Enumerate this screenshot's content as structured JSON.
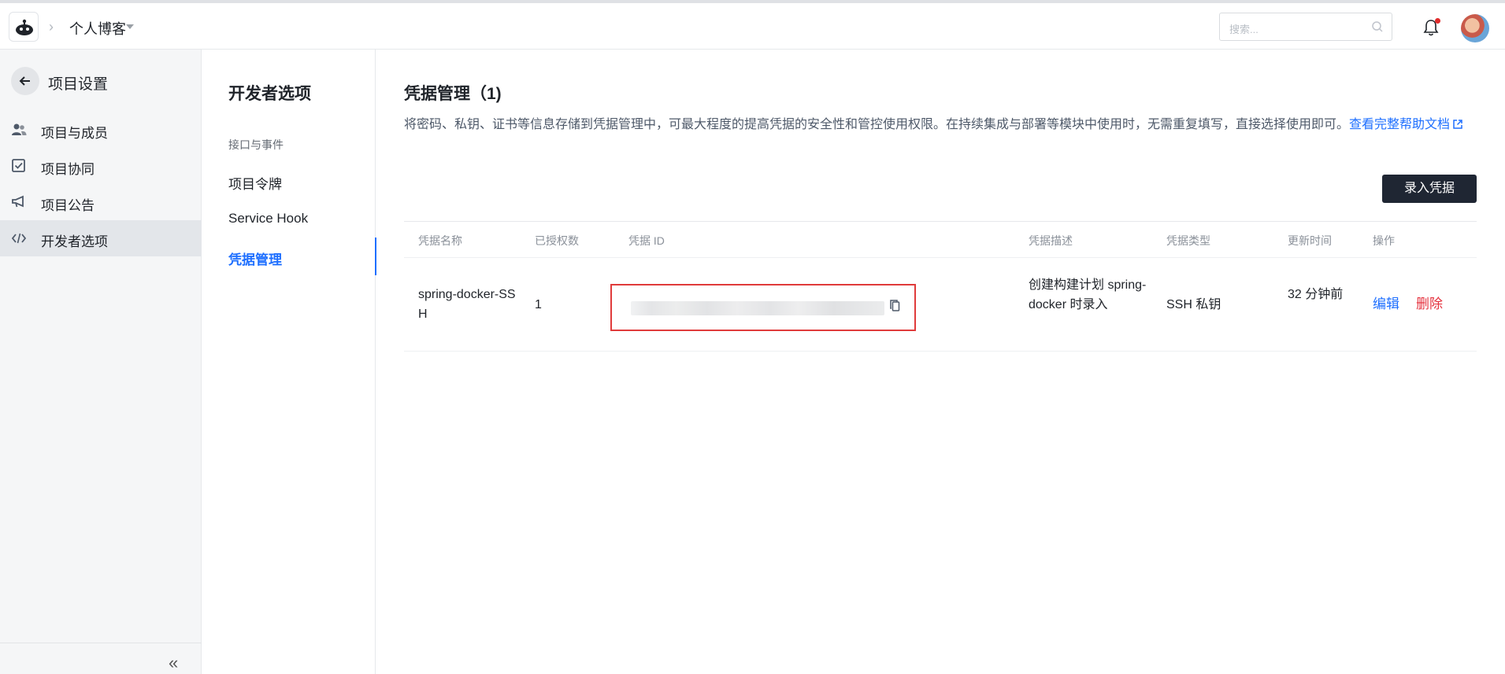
{
  "topbar": {
    "project_name": "个人博客",
    "search_placeholder": "搜索...",
    "icons": [
      "logo-icon",
      "chevron-right-icon",
      "caret-down-icon",
      "search-icon",
      "bell-icon",
      "avatar"
    ]
  },
  "sidebar": {
    "title": "项目设置",
    "items": [
      {
        "label": "项目与成员",
        "icon": "members-icon"
      },
      {
        "label": "项目协同",
        "icon": "collab-icon"
      },
      {
        "label": "项目公告",
        "icon": "megaphone-icon"
      },
      {
        "label": "开发者选项",
        "icon": "code-icon",
        "active": true
      }
    ],
    "collapse_label": "«"
  },
  "subnav": {
    "title": "开发者选项",
    "group_label": "接口与事件",
    "items": [
      {
        "label": "项目令牌"
      },
      {
        "label": "Service Hook"
      },
      {
        "label": "凭据管理",
        "active": true
      }
    ]
  },
  "main": {
    "title": "凭据管理（1)",
    "description": "将密码、私钥、证书等信息存储到凭据管理中，可最大程度的提高凭据的安全性和管控使用权限。在持续集成与部署等模块中使用时，无需重复填写，直接选择使用即可。",
    "help_link": "查看完整帮助文档",
    "add_button": "录入凭据",
    "columns": [
      "凭据名称",
      "已授权数",
      "凭据 ID",
      "凭据描述",
      "凭据类型",
      "更新时间",
      "操作"
    ],
    "rows": [
      {
        "name": "spring-docker-SSH",
        "authorized_count": "1",
        "description": "创建构建计划 spring-docker 时录入",
        "type": "SSH 私钥",
        "updated": "32 分钟前",
        "actions": {
          "edit": "编辑",
          "delete": "删除"
        }
      }
    ]
  },
  "colors": {
    "accent": "#1e6fff",
    "danger": "#e5323e",
    "highlight_box": "#e03b3b",
    "dark_button": "#1f2633"
  }
}
